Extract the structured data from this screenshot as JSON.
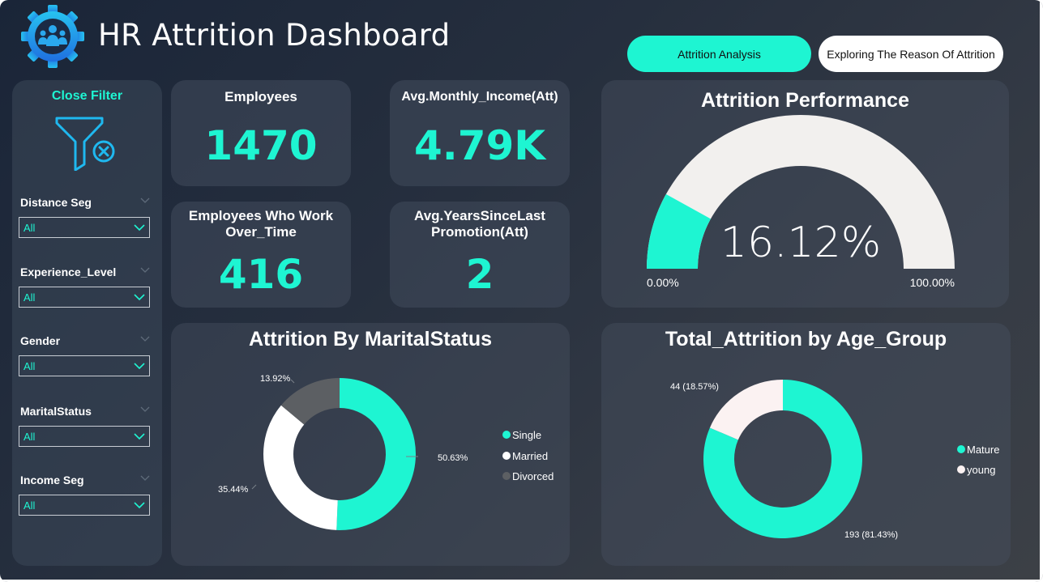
{
  "header": {
    "title": "HR Attrition Dashboard",
    "nav": [
      {
        "label": "Attrition Analysis",
        "active": true
      },
      {
        "label": "Exploring The Reason Of Attrition",
        "active": false
      }
    ],
    "logo_icon": "people-gear-icon"
  },
  "filters": {
    "close_label": "Close Filter",
    "close_icon": "funnel-close-icon",
    "slicers": [
      {
        "label": "Distance Seg",
        "value": "All"
      },
      {
        "label": "Experience_Level",
        "value": "All"
      },
      {
        "label": "Gender",
        "value": "All"
      },
      {
        "label": "MaritalStatus",
        "value": "All"
      },
      {
        "label": "Income Seg",
        "value": "All"
      }
    ]
  },
  "kpis": {
    "employees": {
      "label": "Employees",
      "value": "1470"
    },
    "avg_income": {
      "label": "Avg.Monthly_Income(Att)",
      "value": "4.79K"
    },
    "overtime": {
      "label_line1": "Employees Who Work",
      "label_line2": "Over_Time",
      "value": "416"
    },
    "years_promo": {
      "label_line1": "Avg.YearsSinceLast",
      "label_line2": "Promotion(Att)",
      "value": "2"
    }
  },
  "colors": {
    "accent": "#1ef5d2",
    "light": "#f2f0ee",
    "divorced": "#5c5f63"
  },
  "chart_data": [
    {
      "type": "gauge",
      "title": "Attrition Performance",
      "value": 16.12,
      "value_label": "16.12%",
      "min_label": "0.00%",
      "max_label": "100.00%",
      "range": [
        0,
        100
      ]
    },
    {
      "type": "donut",
      "title": "Attrition By MaritalStatus",
      "categories": [
        "Single",
        "Married",
        "Divorced"
      ],
      "values": [
        50.63,
        35.44,
        13.92
      ],
      "labels": [
        "50.63%",
        "35.44%",
        "13.92%"
      ],
      "colors": [
        "#1ef5d2",
        "#ffffff",
        "#5c5f63"
      ],
      "legend": "right"
    },
    {
      "type": "donut",
      "title": "Total_Attrition by Age_Group",
      "categories": [
        "Mature",
        "young"
      ],
      "values": [
        193,
        44
      ],
      "labels": [
        "193 (81.43%)",
        "44 (18.57%)"
      ],
      "colors": [
        "#1ef5d2",
        "#fbf2f2"
      ],
      "legend": "right"
    }
  ]
}
